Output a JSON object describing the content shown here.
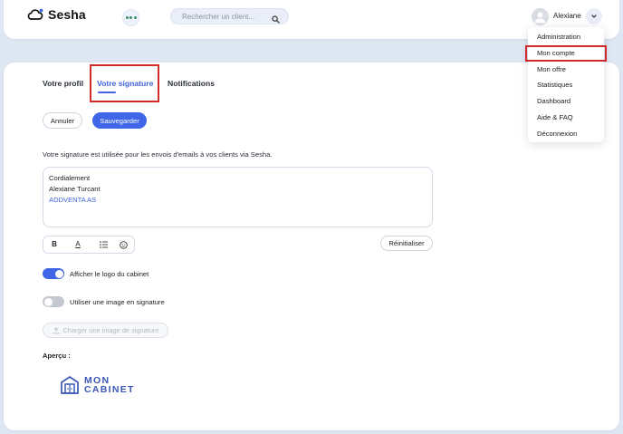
{
  "app": {
    "name": "Sesha"
  },
  "search": {
    "placeholder": "Rechercher un client..."
  },
  "user": {
    "name": "Alexiane"
  },
  "menu": {
    "items": [
      {
        "label": "Administration"
      },
      {
        "label": "Mon compte",
        "active": true
      },
      {
        "label": "Mon offre"
      },
      {
        "label": "Statistiques"
      },
      {
        "label": "Dashboard"
      },
      {
        "label": "Aide & FAQ"
      },
      {
        "label": "Déconnexion"
      }
    ]
  },
  "tabs": [
    {
      "label": "Votre profil"
    },
    {
      "label": "Votre signature",
      "active": true
    },
    {
      "label": "Notifications"
    }
  ],
  "actions": {
    "cancel": "Annuler",
    "save": "Sauvegarder"
  },
  "signature": {
    "description": "Votre signature est utilisée pour les envois d'emails à vos clients via Sesha.",
    "lines": [
      "Cordialement",
      "Alexiane Turcant",
      "ADDVENTA AS"
    ],
    "toolbar": {
      "bold": "B",
      "underline": "A"
    },
    "reset": "Réinitialiser"
  },
  "options": {
    "show_logo": {
      "label": "Afficher le logo du cabinet",
      "on": true
    },
    "use_image": {
      "label": "Utiliser une image en signature",
      "on": false
    },
    "upload": "Charger une image de signature"
  },
  "preview": {
    "label": "Aperçu :",
    "logo_line1": "MON",
    "logo_line2": "CABINET"
  },
  "colors": {
    "accent": "#3f66e6",
    "highlight": "#d12a2a",
    "logo": "#3b57b8"
  }
}
